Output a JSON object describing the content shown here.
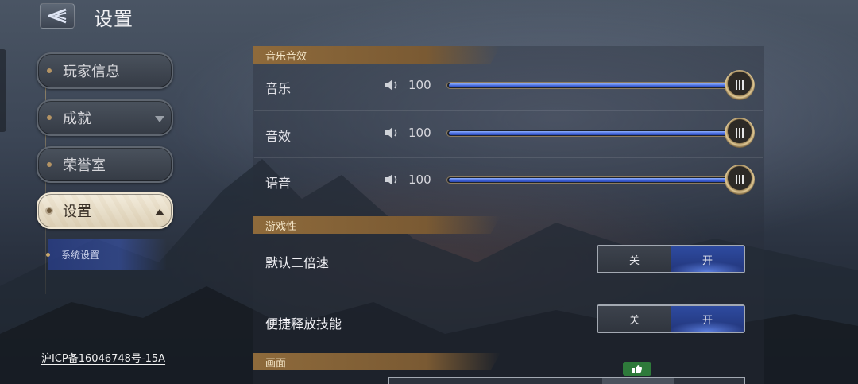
{
  "header": {
    "title": "设置"
  },
  "sidebar": {
    "items": [
      {
        "label": "玩家信息",
        "active": false,
        "chevron": "none"
      },
      {
        "label": "成就",
        "active": false,
        "chevron": "down"
      },
      {
        "label": "荣誉室",
        "active": false,
        "chevron": "none"
      },
      {
        "label": "设置",
        "active": true,
        "chevron": "up"
      }
    ],
    "sub_items": [
      {
        "label": "系统设置",
        "selected": true
      }
    ],
    "footer": "沪ICP备16046748号-15A"
  },
  "sections": {
    "audio": {
      "title": "音乐音效",
      "rows": [
        {
          "label": "音乐",
          "value": "100",
          "level": 1.0,
          "icon": "speaker-icon"
        },
        {
          "label": "音效",
          "value": "100",
          "level": 1.0,
          "icon": "speaker-icon"
        },
        {
          "label": "语音",
          "value": "100",
          "level": 1.0,
          "icon": "speaker-icon"
        }
      ]
    },
    "gameplay": {
      "title": "游戏性",
      "rows": [
        {
          "label": "默认二倍速",
          "off_label": "关",
          "on_label": "开",
          "selected": "on"
        },
        {
          "label": "便捷释放技能",
          "off_label": "关",
          "on_label": "开",
          "selected": "on"
        }
      ]
    },
    "graphics": {
      "title": "画面",
      "badge_icon": "thumbs-up-icon"
    }
  },
  "colors": {
    "accent_blue": "#3f62d6",
    "section_gold": "#8e6a3b",
    "recommend_green": "#2e7a3a"
  }
}
